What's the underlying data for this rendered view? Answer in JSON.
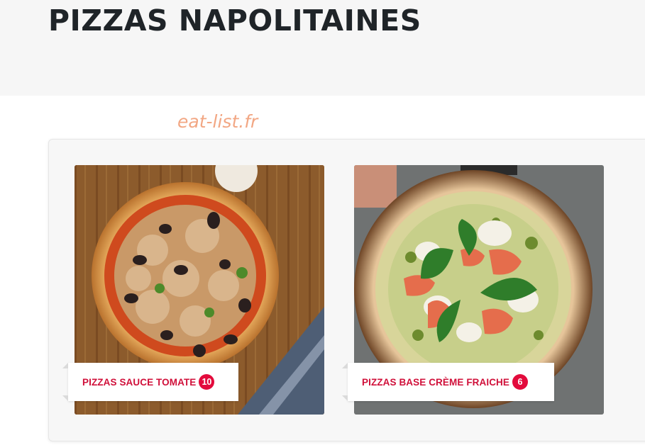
{
  "page": {
    "title": "PIZZAS NAPOLITAINES",
    "watermark": "eat-list.fr"
  },
  "categories": [
    {
      "label": "PIZZAS SAUCE TOMATE",
      "count": "10",
      "image_icon": "pizza-tuna-olives-image"
    },
    {
      "label": "PIZZAS BASE CRÈME FRAICHE",
      "count": "6",
      "image_icon": "pizza-salmon-mozzarella-basil-image"
    }
  ],
  "colors": {
    "accent": "#e30b3c",
    "label_text": "#d0103a",
    "title": "#1f2428",
    "hero_bg": "#f6f6f6",
    "watermark": "#f2a784"
  }
}
